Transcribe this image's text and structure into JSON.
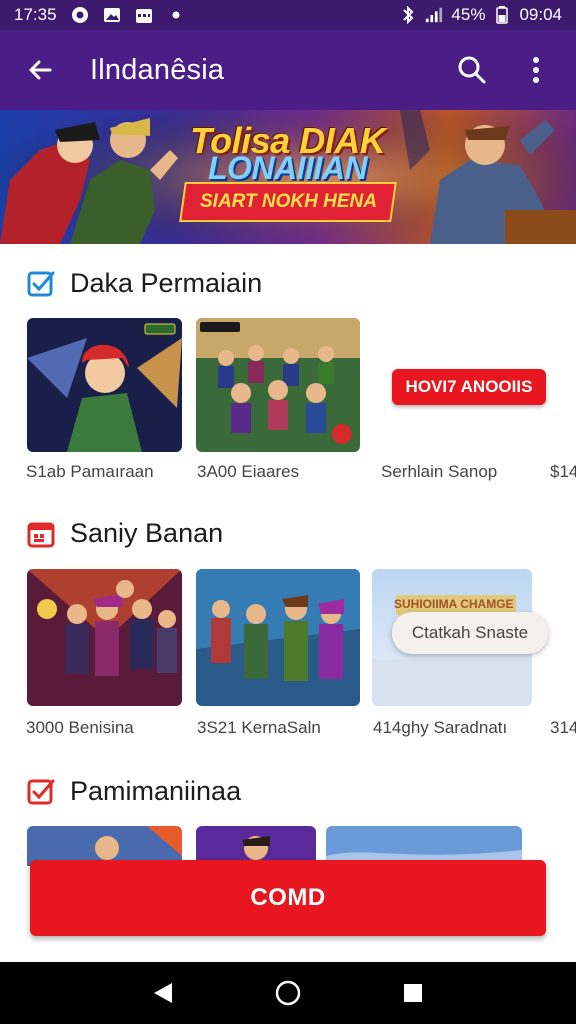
{
  "status_bar": {
    "time": "17:35",
    "battery": "45%",
    "clock": "09:04",
    "icons": [
      "circle-notification-icon",
      "image-notification-icon",
      "calendar-notification-icon",
      "dot-icon",
      "bluetooth-icon",
      "signal-icon",
      "battery-icon"
    ]
  },
  "app_bar": {
    "title": "Ilndanêsia",
    "back_icon": "arrow-left-icon",
    "search_icon": "search-icon",
    "more_icon": "more-vertical-icon"
  },
  "banner": {
    "line1": "Tolisa DIAK",
    "line2": "LONAIIIAN",
    "button": "SIART NOKH HENA"
  },
  "sections": [
    {
      "title": "Daka Permaiain",
      "icon": "checkbox-icon",
      "items": [
        {
          "caption": "S1ab Pamaıraan"
        },
        {
          "caption": "3A00 Eiaares"
        },
        {
          "caption": "Serhlain Sanop"
        },
        {
          "caption": "$14"
        }
      ],
      "action_button": "HOVI7 ANOOIIS"
    },
    {
      "title": "Saniy Banan",
      "icon": "calendar-icon",
      "items": [
        {
          "caption": "3000 Benisina"
        },
        {
          "caption": "3S21 KernaSaln"
        },
        {
          "caption": "414ghy Saradnatı"
        },
        {
          "caption": "314"
        }
      ],
      "popup": "Ctatkah Snaste",
      "third_tile_title": "SUHIOIIMA CHAMGENY"
    },
    {
      "title": "Pamimaniinaa",
      "icon": "check-badge-icon"
    }
  ],
  "cta": {
    "label": "COMD"
  },
  "nav_bar": {
    "back": "triangle-back-icon",
    "home": "circle-home-icon",
    "recents": "square-recents-icon"
  },
  "colors": {
    "status_bar": "#3d1a6e",
    "app_bar": "#4b1d86",
    "accent_red": "#e8161e"
  }
}
